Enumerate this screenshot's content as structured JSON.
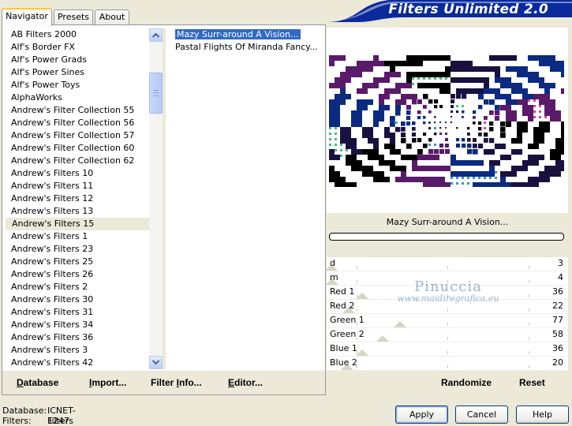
{
  "banner": {
    "title": "Filters Unlimited 2.0"
  },
  "tabs": [
    {
      "label": "Navigator",
      "active": true
    },
    {
      "label": "Presets",
      "active": false
    },
    {
      "label": "About",
      "active": false
    }
  ],
  "categories": {
    "items": [
      "AB Filters 2000",
      "Alf's Border FX",
      "Alf's Power Grads",
      "Alf's Power Sines",
      "Alf's Power Toys",
      "AlphaWorks",
      "Andrew's Filter Collection 55",
      "Andrew's Filter Collection 56",
      "Andrew's Filter Collection 57",
      "Andrew's Filter Collection 60",
      "Andrew's Filter Collection 62",
      "Andrew's Filters 10",
      "Andrew's Filters 11",
      "Andrew's Filters 12",
      "Andrew's Filters 13",
      "Andrew's Filters 15",
      "Andrew's Filters 1",
      "Andrew's Filters 23",
      "Andrew's Filters 25",
      "Andrew's Filters 26",
      "Andrew's Filters 2",
      "Andrew's Filters 30",
      "Andrew's Filters 31",
      "Andrew's Filters 34",
      "Andrew's Filters 36",
      "Andrew's Filters 3",
      "Andrew's Filters 42"
    ],
    "selected": "Andrew's Filters 15"
  },
  "filters": {
    "items": [
      "Mazy Surr-around A Vision...",
      "Pastal Flights Of Miranda Fancy..."
    ],
    "selected": "Mazy Surr-around A Vision..."
  },
  "panel_buttons": {
    "database": {
      "pre": "",
      "u": "D",
      "post": "atabase"
    },
    "import": {
      "pre": "",
      "u": "I",
      "post": "mport..."
    },
    "filter_info": {
      "pre": "Filter ",
      "u": "I",
      "post": "nfo..."
    },
    "editor": {
      "pre": "",
      "u": "E",
      "post": "ditor..."
    },
    "randomize": "Randomize",
    "reset": "Reset"
  },
  "preview": {
    "filter_name": "Mazy Surr-around A Vision..."
  },
  "params": [
    {
      "name": "d",
      "value": "3",
      "max": 255
    },
    {
      "name": "m",
      "value": "4",
      "max": 255
    },
    {
      "name": "Red 1",
      "value": "36",
      "max": 255
    },
    {
      "name": "Red 2",
      "value": "22",
      "max": 255
    },
    {
      "name": "Green 1",
      "value": "77",
      "max": 255
    },
    {
      "name": "Green 2",
      "value": "58",
      "max": 255
    },
    {
      "name": "Blue 1",
      "value": "36",
      "max": 255
    },
    {
      "name": "Blue 2",
      "value": "20",
      "max": 255
    }
  ],
  "watermark": {
    "line1": "Pinuccia",
    "line2": "www.maidiregrafica.eu"
  },
  "status": {
    "database_label": "Database:",
    "database_value": "ICNET-Filters",
    "filters_label": "Filters:",
    "filters_value": "1247"
  },
  "dialog_buttons": {
    "apply": "Apply",
    "cancel": "Cancel",
    "help": "Help"
  }
}
